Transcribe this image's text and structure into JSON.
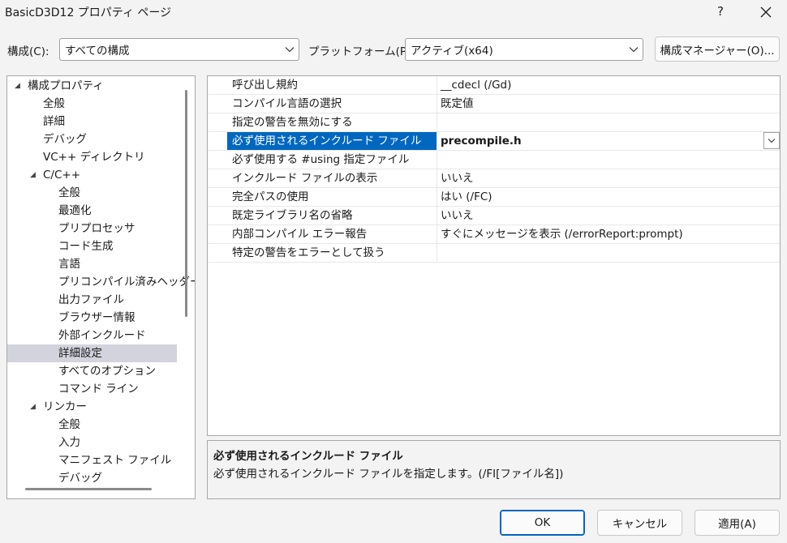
{
  "window": {
    "title": "BasicD3D12 プロパティ ページ",
    "help_label": "?"
  },
  "config_bar": {
    "config_label": "構成(C):",
    "config_value": "すべての構成",
    "platform_label": "プラットフォーム(P):",
    "platform_value": "アクティブ(x64)",
    "manager_button": "構成マネージャー(O)..."
  },
  "tree": {
    "items": [
      {
        "label": "構成プロパティ",
        "expanded": true
      },
      {
        "label": "全般"
      },
      {
        "label": "詳細"
      },
      {
        "label": "デバッグ"
      },
      {
        "label": "VC++ ディレクトリ"
      },
      {
        "label": "C/C++",
        "expanded": true
      },
      {
        "label": "全般"
      },
      {
        "label": "最適化"
      },
      {
        "label": "プリプロセッサ"
      },
      {
        "label": "コード生成"
      },
      {
        "label": "言語"
      },
      {
        "label": "プリコンパイル済みヘッダー"
      },
      {
        "label": "出力ファイル"
      },
      {
        "label": "ブラウザー情報"
      },
      {
        "label": "外部インクルード"
      },
      {
        "label": "詳細設定",
        "selected": true
      },
      {
        "label": "すべてのオプション"
      },
      {
        "label": "コマンド ライン"
      },
      {
        "label": "リンカー",
        "expanded": true
      },
      {
        "label": "全般"
      },
      {
        "label": "入力"
      },
      {
        "label": "マニフェスト ファイル"
      },
      {
        "label": "デバッグ"
      }
    ]
  },
  "grid": {
    "rows": [
      {
        "name": "呼び出し規約",
        "value": "__cdecl (/Gd)"
      },
      {
        "name": "コンパイル言語の選択",
        "value": "既定値"
      },
      {
        "name": "指定の警告を無効にする",
        "value": ""
      },
      {
        "name": "必ず使用されるインクルード ファイル",
        "value": "precompile.h",
        "selected": true
      },
      {
        "name": "必ず使用する #using 指定ファイル",
        "value": ""
      },
      {
        "name": "インクルード ファイルの表示",
        "value": "いいえ"
      },
      {
        "name": "完全パスの使用",
        "value": "はい (/FC)"
      },
      {
        "name": "既定ライブラリ名の省略",
        "value": "いいえ"
      },
      {
        "name": "内部コンパイル エラー報告",
        "value": "すぐにメッセージを表示 (/errorReport:prompt)"
      },
      {
        "name": "特定の警告をエラーとして扱う",
        "value": ""
      }
    ]
  },
  "description": {
    "title": "必ず使用されるインクルード ファイル",
    "text": "必ず使用されるインクルード ファイルを指定します。(/FI[ファイル名])"
  },
  "footer": {
    "ok": "OK",
    "cancel": "キャンセル",
    "apply": "適用(A)"
  },
  "colors": {
    "selection": "#0067c0",
    "tree_selection": "#d3d3dd",
    "background": "#f3f3f3"
  }
}
